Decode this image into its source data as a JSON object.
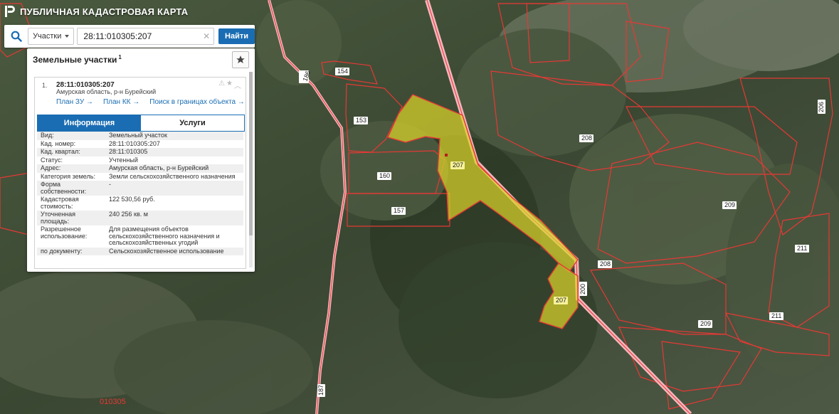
{
  "app": {
    "title": "ПУБЛИЧНАЯ КАДАСТРОВАЯ КАРТА"
  },
  "search": {
    "type_label": "Участки",
    "query": "28:11:010305:207",
    "find_label": "Найти"
  },
  "panel": {
    "title": "Земельные участки",
    "count": "1",
    "item": {
      "number": "1.",
      "id": "28:11:010305:207",
      "address": "Амурская область, р-н Бурейский",
      "links": [
        "План ЗУ →",
        "План КК →",
        "Поиск в границах объекта →"
      ]
    },
    "tabs": [
      {
        "label": "Информация",
        "active": true
      },
      {
        "label": "Услуги",
        "active": false
      }
    ],
    "attributes": [
      {
        "key": "Вид:",
        "value": "Земельный участок",
        "link": false
      },
      {
        "key": "Кад. номер:",
        "value": "28:11:010305:207",
        "link": true
      },
      {
        "key": "Кад. квартал:",
        "value": "28:11:010305",
        "link": true
      },
      {
        "key": "Статус:",
        "value": "Учтенный",
        "link": false
      },
      {
        "key": "Адрес:",
        "value": "Амурская область, р-н Бурейский",
        "link": false
      },
      {
        "key": "Категория земель:",
        "value": "Земли сельскохозяйственного назначения",
        "link": false
      },
      {
        "key": "Форма собственности:",
        "value": "-",
        "link": false
      },
      {
        "key": "Кадастровая стоимость:",
        "value": "122 530,56 руб.",
        "link": false
      },
      {
        "key": "Уточненная площадь:",
        "value": "240 256 кв. м",
        "link": false
      },
      {
        "key": "Разрешенное использование:",
        "value": "Для размещения объектов сельскохозяйственного назначения и сельскохозяйственных угодий",
        "link": false
      },
      {
        "key": "по документу:",
        "value": "Сельскохозяйственное использование",
        "link": false
      }
    ]
  },
  "map": {
    "parcel_labels": [
      "154",
      "153",
      "160",
      "157",
      "207",
      "207",
      "208",
      "208",
      "209",
      "209",
      "211",
      "211",
      "206",
      "186",
      "200",
      "187"
    ],
    "quarter_label": "010305",
    "colors": {
      "boundary": "#e53935",
      "selected_fill": "#d9d22a",
      "road": "#f4b6bd"
    }
  }
}
